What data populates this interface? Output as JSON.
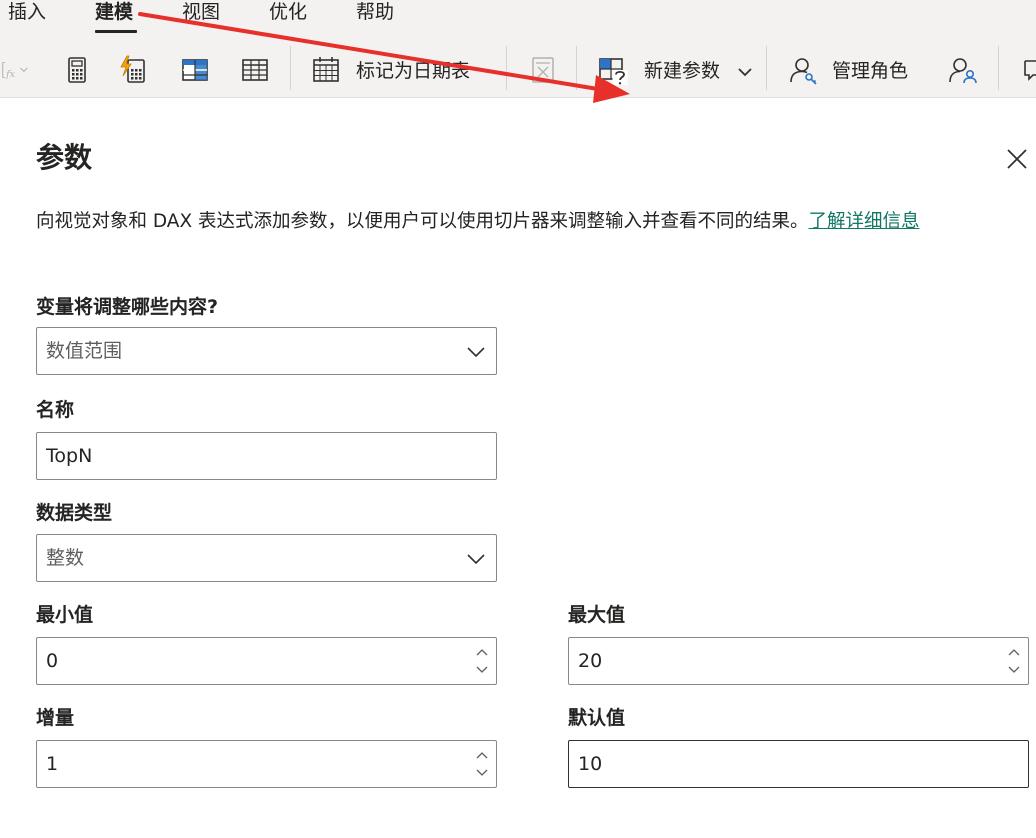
{
  "menu": {
    "tabs": [
      "插入",
      "建模",
      "视图",
      "优化",
      "帮助"
    ],
    "active_index": 1
  },
  "ribbon": {
    "mark_as_date_table": "标记为日期表",
    "new_parameter": "新建参数",
    "manage_roles": "管理角色"
  },
  "panel": {
    "title": "参数",
    "description": "向视觉对象和 DAX 表达式添加参数，以便用户可以使用切片器来调整输入并查看不同的结果。",
    "learn_more": "了解详细信息"
  },
  "form": {
    "variable_label": "变量将调整哪些内容?",
    "variable_value": "数值范围",
    "name_label": "名称",
    "name_value": "TopN",
    "datatype_label": "数据类型",
    "datatype_value": "整数",
    "min_label": "最小值",
    "min_value": "0",
    "max_label": "最大值",
    "max_value": "20",
    "increment_label": "增量",
    "increment_value": "1",
    "default_label": "默认值",
    "default_value": "10"
  },
  "colors": {
    "link": "#117865",
    "annotation_arrow": "#e8302a",
    "ribbon_background": "#f3f2f1"
  }
}
